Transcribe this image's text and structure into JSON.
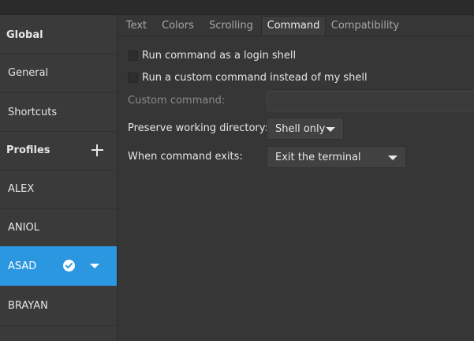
{
  "sidebar": {
    "global_label": "Global",
    "general_label": "General",
    "shortcuts_label": "Shortcuts",
    "profiles_label": "Profiles",
    "profiles": [
      {
        "name": "ALEX"
      },
      {
        "name": "ANIOL"
      },
      {
        "name": "ASAD",
        "selected": true,
        "default": true
      },
      {
        "name": "BRAYAN"
      }
    ]
  },
  "tabs": [
    {
      "label": "Text",
      "active": false
    },
    {
      "label": "Colors",
      "active": false
    },
    {
      "label": "Scrolling",
      "active": false
    },
    {
      "label": "Command",
      "active": true
    },
    {
      "label": "Compatibility",
      "active": false
    }
  ],
  "command": {
    "login_shell_label": "Run command as a login shell",
    "login_shell_checked": false,
    "custom_command_label": "Run a custom command instead of my shell",
    "custom_command_checked": false,
    "custom_command_field_label": "Custom command:",
    "custom_command_value": "",
    "preserve_label": "Preserve working directory:",
    "preserve_value": "Shell only",
    "exit_label": "When command exits:",
    "exit_value": "Exit the terminal"
  },
  "colors": {
    "accent": "#2b97e0",
    "background": "#363636",
    "sidebar_background": "#3a3a3a"
  },
  "icons": [
    "add-profile-icon",
    "default-profile-check-icon",
    "profile-menu-chevron-icon",
    "dropdown-chevron-icon"
  ]
}
